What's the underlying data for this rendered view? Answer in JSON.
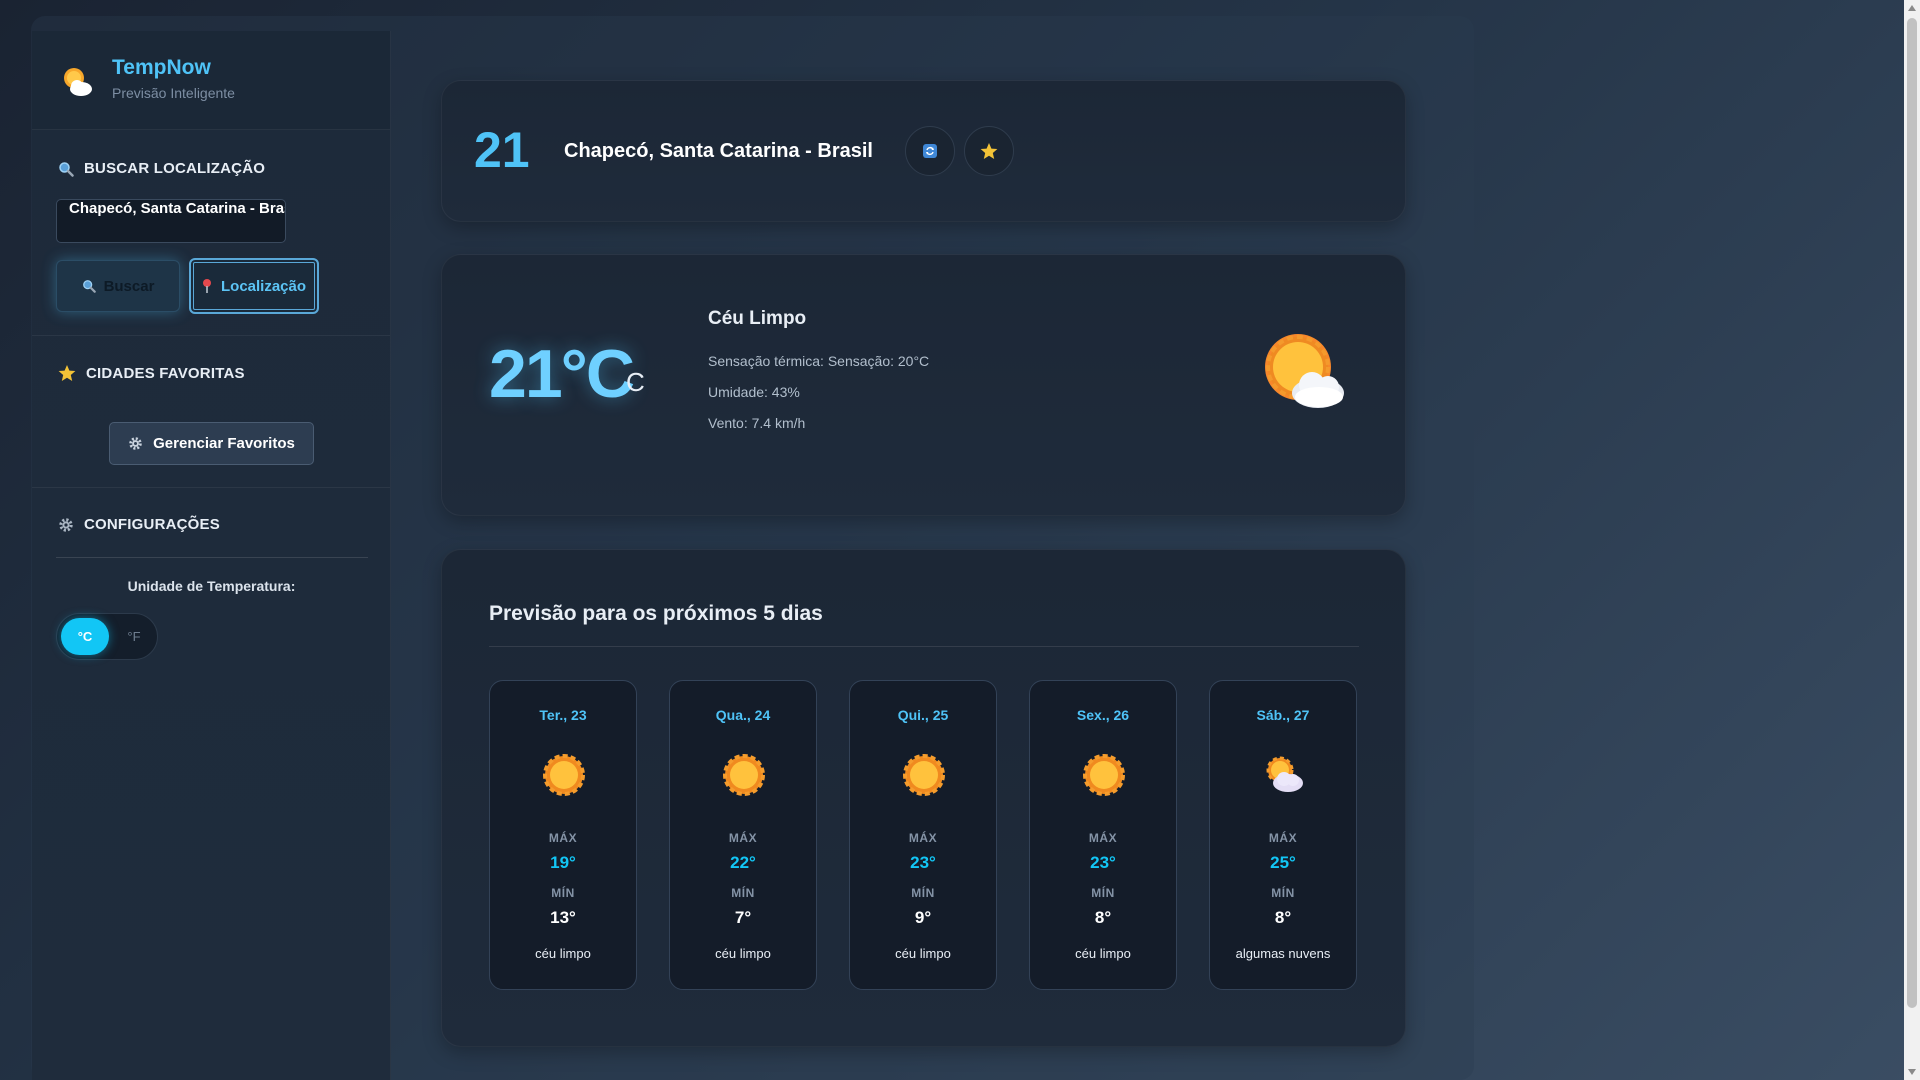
{
  "brand": {
    "title": "TempNow",
    "subtitle": "Previsão Inteligente",
    "icon": "sun-cloud-icon"
  },
  "sidebar": {
    "search": {
      "title": "BUSCAR LOCALIZAÇÃO",
      "icon": "search-icon",
      "input_value": "Chapecó, Santa Catarina - Brasil",
      "search_button": "Buscar",
      "location_button": "Localização"
    },
    "favorites": {
      "title": "CIDADES FAVORITAS",
      "icon": "star-icon",
      "manage_button": "Gerenciar Favoritos"
    },
    "settings": {
      "title": "CONFIGURAÇÕES",
      "icon": "gear-icon",
      "unit_label": "Unidade de Temperatura:",
      "unit_c": "°C",
      "unit_f": "°F",
      "selected_unit": "°C"
    }
  },
  "header": {
    "number": "21",
    "location": "Chapecó, Santa Catarina - Brasil"
  },
  "current": {
    "temp": "21°C",
    "unit": "C",
    "condition": "Céu Limpo",
    "feels_like": "Sensação térmica: Sensação: 20°C",
    "humidity": "Umidade: 43%",
    "wind": "Vento: 7.4 km/h",
    "icon": "sun-cloud-icon"
  },
  "forecast": {
    "title": "Previsão para os próximos 5 dias",
    "max_label": "MÁX",
    "min_label": "MÍN",
    "days": [
      {
        "day": "Ter., 23",
        "max": "19°",
        "min": "13°",
        "desc": "céu limpo",
        "icon": "sun-icon"
      },
      {
        "day": "Qua., 24",
        "max": "22°",
        "min": "7°",
        "desc": "céu limpo",
        "icon": "sun-icon"
      },
      {
        "day": "Qui., 25",
        "max": "23°",
        "min": "9°",
        "desc": "céu limpo",
        "icon": "sun-icon"
      },
      {
        "day": "Sex., 26",
        "max": "23°",
        "min": "8°",
        "desc": "céu limpo",
        "icon": "sun-icon"
      },
      {
        "day": "Sáb., 27",
        "max": "25°",
        "min": "8°",
        "desc": "algumas nuvens",
        "icon": "sun-cloud-icon"
      }
    ]
  },
  "colors": {
    "accent": "#4fc3f7",
    "accent_strong": "#12c6f5",
    "background": "#1a2332"
  }
}
